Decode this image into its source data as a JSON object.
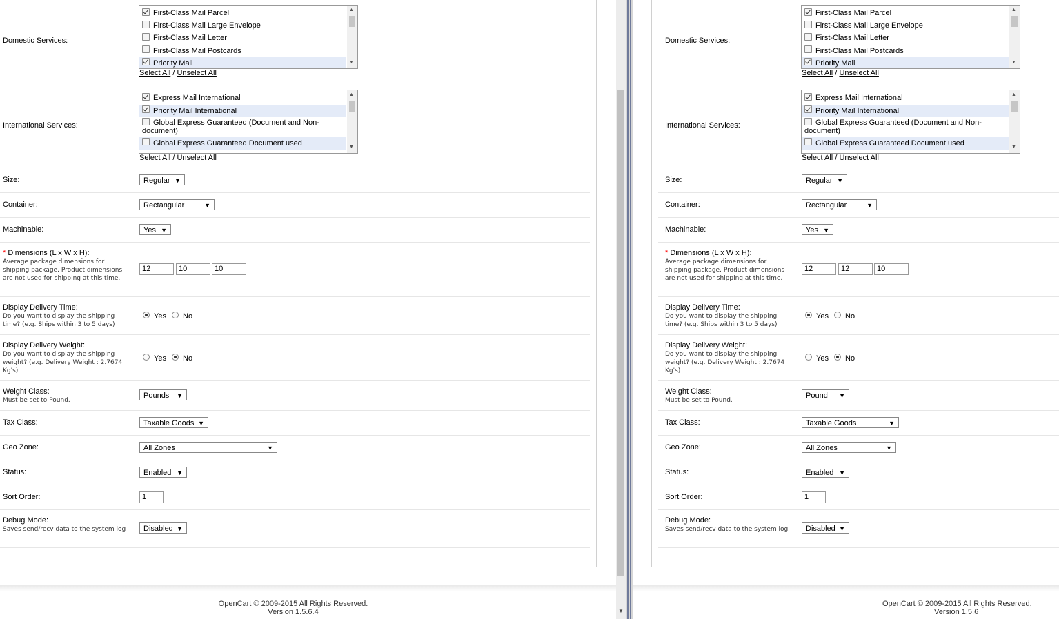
{
  "left": {
    "domestic": {
      "label": "Domestic Services:",
      "options": [
        {
          "text": "First-Class Mail Parcel",
          "checked": true
        },
        {
          "text": "First-Class Mail Large Envelope",
          "checked": false
        },
        {
          "text": "First-Class Mail Letter",
          "checked": false
        },
        {
          "text": "First-Class Mail Postcards",
          "checked": false
        },
        {
          "text": "Priority Mail",
          "checked": true
        }
      ]
    },
    "international": {
      "label": "International Services:",
      "options": [
        {
          "text": "Express Mail International",
          "checked": true
        },
        {
          "text": "Priority Mail International",
          "checked": true
        },
        {
          "text": "Global Express Guaranteed (Document and Non-document)",
          "checked": false
        },
        {
          "text": "Global Express Guaranteed Document used",
          "checked": false
        }
      ]
    },
    "select_all": "Select All",
    "slash": "/",
    "unselect_all": "Unselect All",
    "size": {
      "label": "Size:",
      "value": "Regular"
    },
    "container": {
      "label": "Container:",
      "value": "Rectangular"
    },
    "machinable": {
      "label": "Machinable:",
      "value": "Yes"
    },
    "dimensions": {
      "required_mark": "*",
      "label": "Dimensions (L x W x H):",
      "help": "Average package dimensions for shipping package. Product dimensions are not used for shipping at this time.",
      "length": "12",
      "width": "10",
      "height": "10"
    },
    "delivery_time": {
      "label": "Display Delivery Time:",
      "help": "Do you want to display the shipping time? (e.g. Ships within 3 to 5 days)",
      "yes": "Yes",
      "no": "No",
      "selected": "yes"
    },
    "delivery_weight": {
      "label": "Display Delivery Weight:",
      "help": "Do you want to display the shipping weight? (e.g. Delivery Weight : 2.7674 Kg's)",
      "yes": "Yes",
      "no": "No",
      "selected": "no"
    },
    "weight_class": {
      "label": "Weight Class:",
      "help": "Must be set to Pound.",
      "value": "Pounds"
    },
    "tax_class": {
      "label": "Tax Class:",
      "value": "Taxable Goods"
    },
    "geo_zone": {
      "label": "Geo Zone:",
      "value": "All Zones"
    },
    "status": {
      "label": "Status:",
      "value": "Enabled"
    },
    "sort_order": {
      "label": "Sort Order:",
      "value": "1"
    },
    "debug": {
      "label": "Debug Mode:",
      "help": "Saves send/recv data to the system log",
      "value": "Disabled"
    },
    "footer": {
      "link": "OpenCart",
      "rights": "© 2009-2015 All Rights Reserved.",
      "version": "Version 1.5.6.4"
    }
  },
  "right": {
    "domestic": {
      "label": "Domestic Services:",
      "options": [
        {
          "text": "First-Class Mail Parcel",
          "checked": true
        },
        {
          "text": "First-Class Mail Large Envelope",
          "checked": false
        },
        {
          "text": "First-Class Mail Letter",
          "checked": false
        },
        {
          "text": "First-Class Mail Postcards",
          "checked": false
        },
        {
          "text": "Priority Mail",
          "checked": true
        }
      ]
    },
    "international": {
      "label": "International Services:",
      "options": [
        {
          "text": "Express Mail International",
          "checked": true
        },
        {
          "text": "Priority Mail International",
          "checked": true
        },
        {
          "text": "Global Express Guaranteed (Document and Non-document)",
          "checked": false
        },
        {
          "text": "Global Express Guaranteed Document used",
          "checked": false
        }
      ]
    },
    "select_all": "Select All",
    "slash": "/",
    "unselect_all": "Unselect All",
    "size": {
      "label": "Size:",
      "value": "Regular"
    },
    "container": {
      "label": "Container:",
      "value": "Rectangular"
    },
    "machinable": {
      "label": "Machinable:",
      "value": "Yes"
    },
    "dimensions": {
      "required_mark": "*",
      "label": "Dimensions (L x W x H):",
      "help": "Average package dimensions for shipping package. Product dimensions are not used for shipping at this time.",
      "length": "12",
      "width": "12",
      "height": "10"
    },
    "delivery_time": {
      "label": "Display Delivery Time:",
      "help": "Do you want to display the shipping time? (e.g. Ships within 3 to 5 days)",
      "yes": "Yes",
      "no": "No",
      "selected": "yes"
    },
    "delivery_weight": {
      "label": "Display Delivery Weight:",
      "help": "Do you want to display the shipping weight? (e.g. Delivery Weight : 2.7674 Kg's)",
      "yes": "Yes",
      "no": "No",
      "selected": "no"
    },
    "weight_class": {
      "label": "Weight Class:",
      "help": "Must be set to Pound.",
      "value": "Pound"
    },
    "tax_class": {
      "label": "Tax Class:",
      "value": "Taxable Goods"
    },
    "geo_zone": {
      "label": "Geo Zone:",
      "value": "All Zones"
    },
    "status": {
      "label": "Status:",
      "value": "Enabled"
    },
    "sort_order": {
      "label": "Sort Order:",
      "value": "1"
    },
    "debug": {
      "label": "Debug Mode:",
      "help": "Saves send/recv data to the system log",
      "value": "Disabled"
    },
    "footer": {
      "link": "OpenCart",
      "rights": "© 2009-2015 All Rights Reserved.",
      "version": "Version 1.5.6"
    }
  }
}
